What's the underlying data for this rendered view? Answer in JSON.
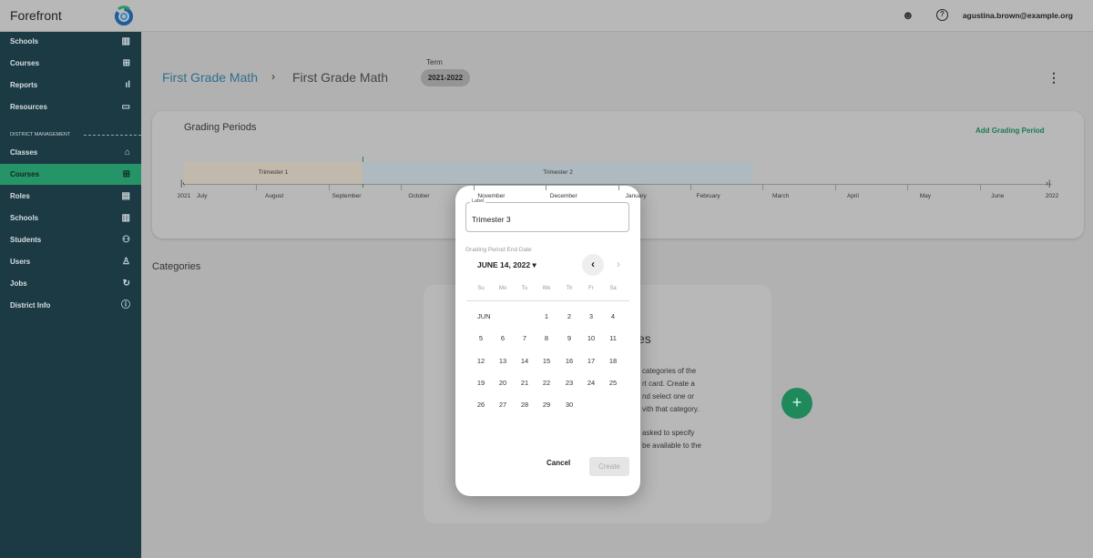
{
  "app": {
    "name": "Forefront",
    "user_email": "agustina.brown@example.org"
  },
  "sidebar": {
    "items": [
      {
        "label": "Schools",
        "icon": "building-icon",
        "glyph": "▥"
      },
      {
        "label": "Courses",
        "icon": "widgets-icon",
        "glyph": "⊞"
      },
      {
        "label": "Reports",
        "icon": "bar-chart-icon",
        "glyph": "ıl"
      },
      {
        "label": "Resources",
        "icon": "folder-icon",
        "glyph": "▭"
      }
    ],
    "section_label": "DISTRICT MANAGEMENT",
    "district_items": [
      {
        "label": "Classes",
        "icon": "school-icon",
        "glyph": "⌂"
      },
      {
        "label": "Courses",
        "icon": "widgets-icon",
        "glyph": "⊞",
        "active": true
      },
      {
        "label": "Roles",
        "icon": "badge-icon",
        "glyph": "▤"
      },
      {
        "label": "Schools",
        "icon": "building-icon",
        "glyph": "▥"
      },
      {
        "label": "Students",
        "icon": "people-icon",
        "glyph": "⚇"
      },
      {
        "label": "Users",
        "icon": "person-icon",
        "glyph": "♙"
      },
      {
        "label": "Jobs",
        "icon": "sync-icon",
        "glyph": "↻"
      },
      {
        "label": "District Info",
        "icon": "info-icon",
        "glyph": "ⓘ"
      }
    ]
  },
  "breadcrumb": [
    "First Grade Math",
    "First Grade Math"
  ],
  "breadcrumb_sep": "›",
  "term": {
    "label": "Term",
    "value": "2021-2022"
  },
  "grading_periods": {
    "title": "Grading Periods",
    "add_label": "Add Grading Period",
    "start_year": "2021",
    "end_year": "2022",
    "months": [
      "July",
      "August",
      "September",
      "October",
      "November",
      "December",
      "January",
      "February",
      "March",
      "April",
      "May",
      "June"
    ],
    "periods": [
      {
        "name": "Trimester 1",
        "color": "#c2b9ad"
      },
      {
        "name": "Trimester 2",
        "color": "#aebabf"
      }
    ]
  },
  "categories": {
    "title": "Categories",
    "heading_fragment": "es",
    "text_fragments": [
      "categories of the",
      "rt card. Create a",
      "nd select one or",
      "vith that category.",
      "asked to specify",
      "be available to the"
    ]
  },
  "dialog": {
    "label_caption": "Label",
    "label_value": "Trimester 3",
    "end_date_caption": "Grading Period End Date",
    "selected_date": "JUNE 14, 2022 ▾",
    "weekdays": [
      "Su",
      "Mo",
      "Tu",
      "We",
      "Th",
      "Fr",
      "Sa"
    ],
    "month_label": "JUN",
    "first_weekday": 3,
    "days_in_month": 30,
    "cancel": "Cancel",
    "create": "Create"
  },
  "colors": {
    "sidebar": "#1c3a44",
    "accent": "#259466"
  }
}
